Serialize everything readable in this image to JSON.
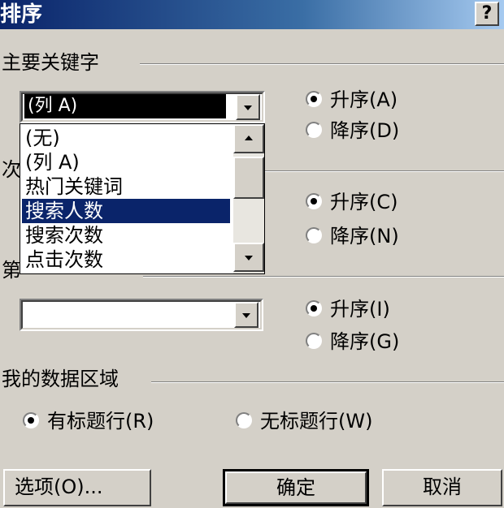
{
  "dialog": {
    "title": "排序",
    "help": "?"
  },
  "primary_key": {
    "label": "主要关键字",
    "selected": "(列 A)",
    "ascending": "升序(A)",
    "descending": "降序(D)",
    "ascending_checked": true
  },
  "dropdown_list": {
    "items": [
      "(无)",
      "(列 A)",
      "热门关键词",
      "搜索人数",
      "搜索次数",
      "点击次数"
    ],
    "selected_index": 3
  },
  "secondary_key": {
    "label_visible": "次",
    "ascending": "升序(C)",
    "descending": "降序(N)",
    "ascending_checked": true
  },
  "third_key": {
    "label_visible": "第",
    "value": "",
    "ascending": "升序(I)",
    "descending": "降序(G)",
    "ascending_checked": true
  },
  "data_range": {
    "label": "我的数据区域",
    "has_header": "有标题行(R)",
    "no_header": "无标题行(W)",
    "has_header_checked": true
  },
  "buttons": {
    "options": "选项(O)...",
    "ok": "确定",
    "cancel": "取消"
  }
}
